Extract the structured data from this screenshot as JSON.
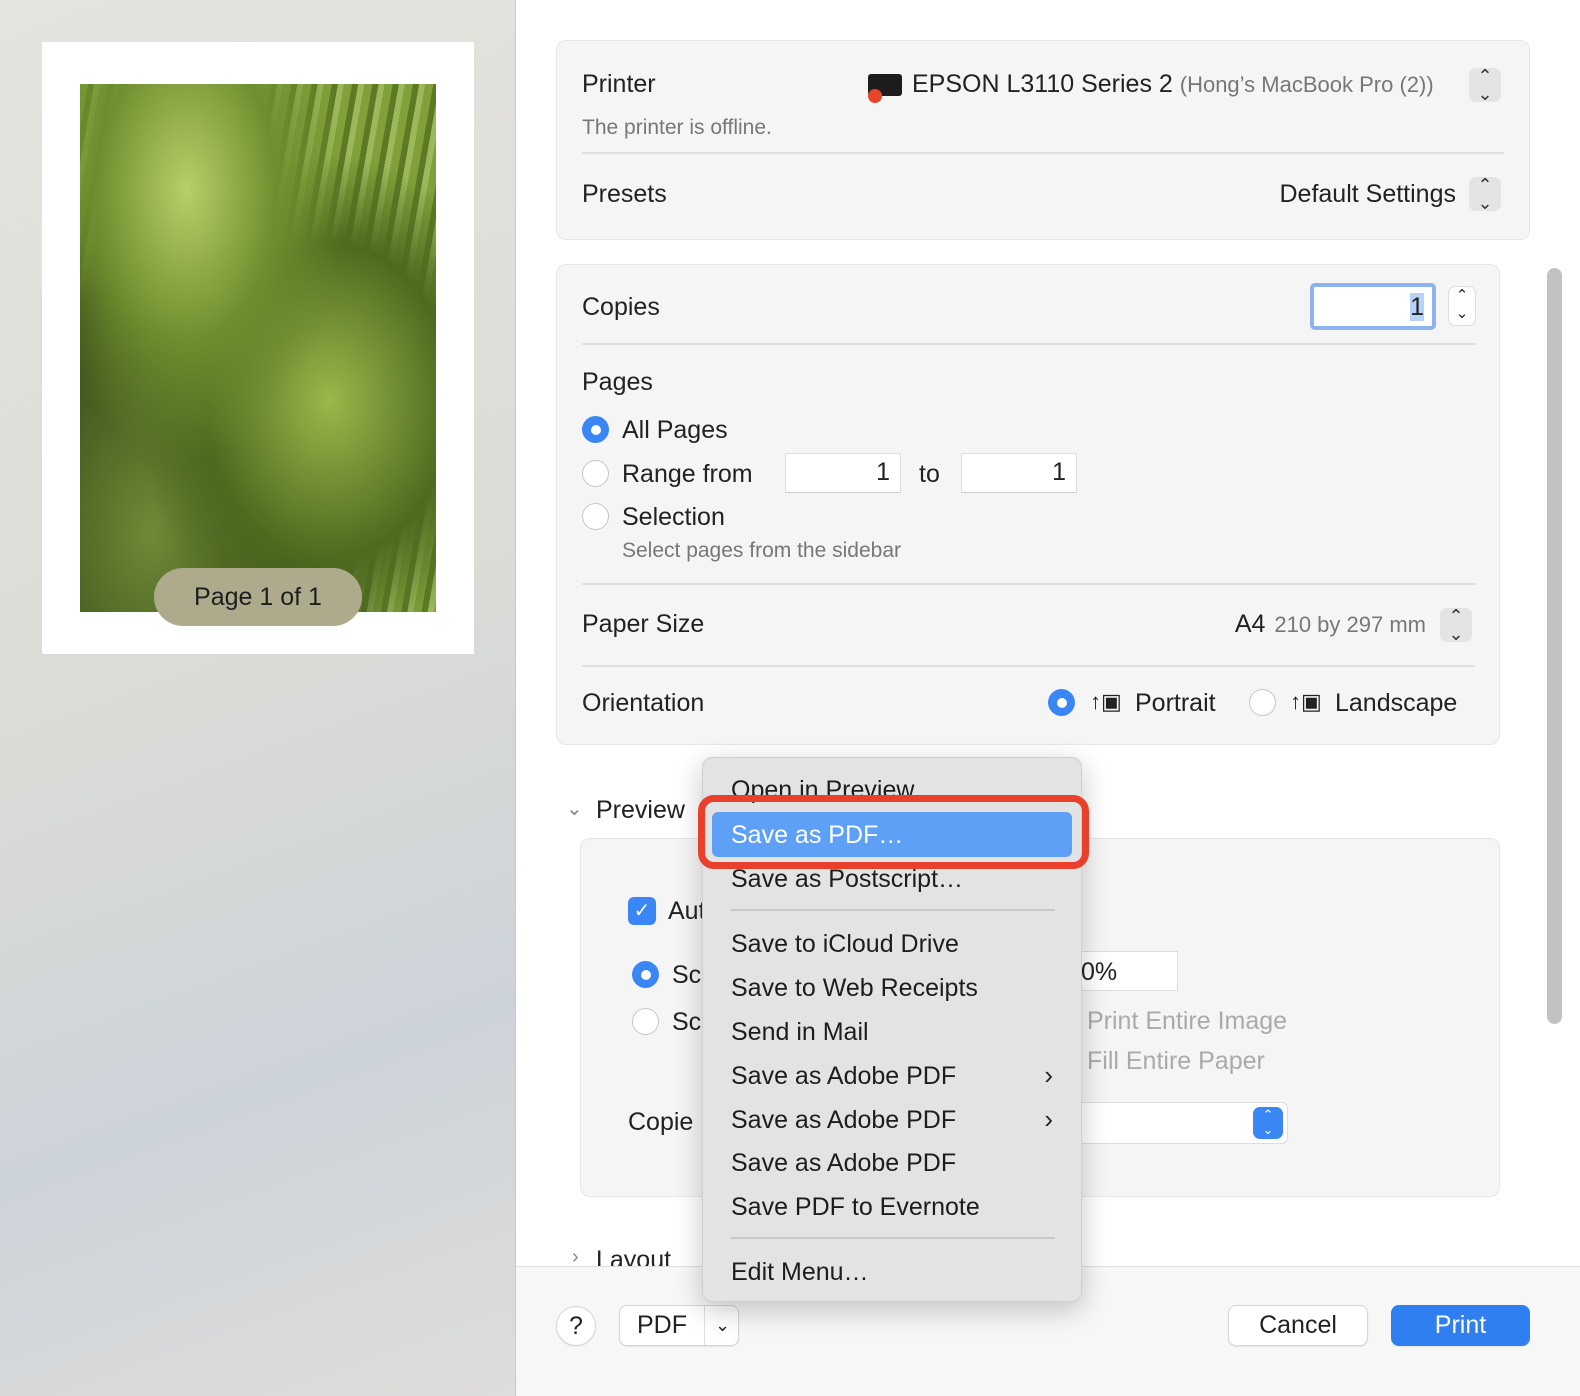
{
  "sidebar": {
    "page_badge": "Page 1 of 1"
  },
  "printer": {
    "label": "Printer",
    "name": "EPSON L3110 Series 2",
    "host": "(Hong’s MacBook Pro (2))",
    "status": "The printer is offline.",
    "status_color": "#e8442c"
  },
  "presets": {
    "label": "Presets",
    "value": "Default Settings"
  },
  "copies": {
    "label": "Copies",
    "value": "1"
  },
  "pages": {
    "label": "Pages",
    "all": "All Pages",
    "range": "Range from",
    "range_from": "1",
    "to": "to",
    "range_to": "1",
    "selection": "Selection",
    "selection_hint": "Select pages from the sidebar",
    "selected": "All Pages"
  },
  "paper": {
    "label": "Paper Size",
    "size": "A4",
    "dims": "210 by 297 mm"
  },
  "orientation": {
    "label": "Orientation",
    "portrait": "Portrait",
    "landscape": "Landscape",
    "selected": "Portrait"
  },
  "preview_section": {
    "title": "Preview",
    "auto_label": "Aut",
    "scale_label": "Sc",
    "scale_fit_label": "Sc",
    "scale_value": "0%",
    "print_entire": "Print Entire Image",
    "fill_entire": "Fill Entire Paper",
    "copies_label": "Copie"
  },
  "layout_section": {
    "title": "Layout"
  },
  "menu": {
    "items": [
      "Open in Preview",
      "Save as PDF…",
      "Save as Postscript…",
      "Save to iCloud Drive",
      "Save to Web Receipts",
      "Send in Mail",
      "Save as Adobe PDF",
      "Save as Adobe PDF",
      "Save as Adobe PDF",
      "Save PDF to Evernote",
      "Edit Menu…"
    ],
    "highlighted": "Save as PDF…",
    "highlight_color": "#5fa0f7",
    "annotation_color": "#e8402a"
  },
  "footer": {
    "help": "?",
    "pdf": "PDF",
    "cancel": "Cancel",
    "print": "Print",
    "accent": "#2f7ff0"
  }
}
